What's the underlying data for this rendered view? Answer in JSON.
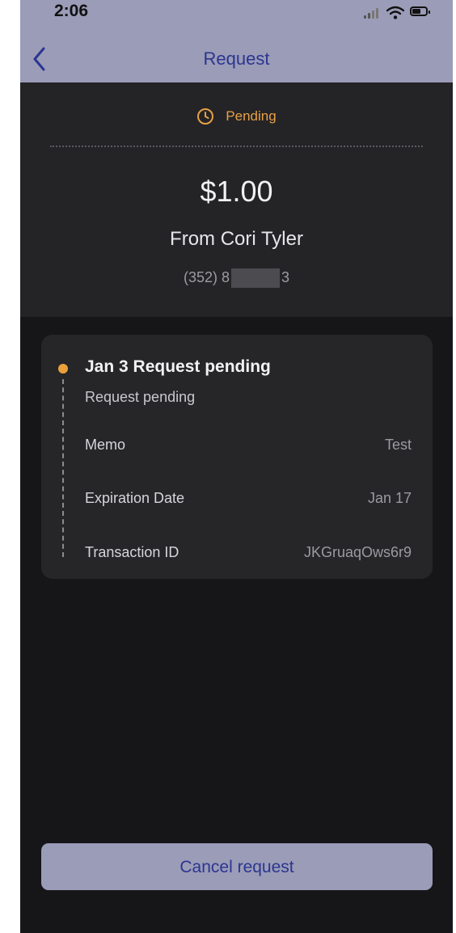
{
  "status_bar": {
    "time": "2:06"
  },
  "nav": {
    "title": "Request"
  },
  "summary": {
    "status": "Pending",
    "amount": "$1.00",
    "from": "From Cori Tyler",
    "phone_prefix": "(352) 8",
    "phone_suffix": "3"
  },
  "card": {
    "title": "Jan 3 Request pending",
    "subtitle": "Request pending",
    "rows": [
      {
        "label": "Memo",
        "value": "Test"
      },
      {
        "label": "Expiration Date",
        "value": "Jan 17"
      },
      {
        "label": "Transaction ID",
        "value": "JKGruaqOws6r9"
      }
    ]
  },
  "actions": {
    "cancel_label": "Cancel request"
  },
  "colors": {
    "header": "#9b9cb7",
    "accent_text": "#2c3590",
    "pending": "#e7a045",
    "background": "#161619",
    "card": "#262629"
  }
}
